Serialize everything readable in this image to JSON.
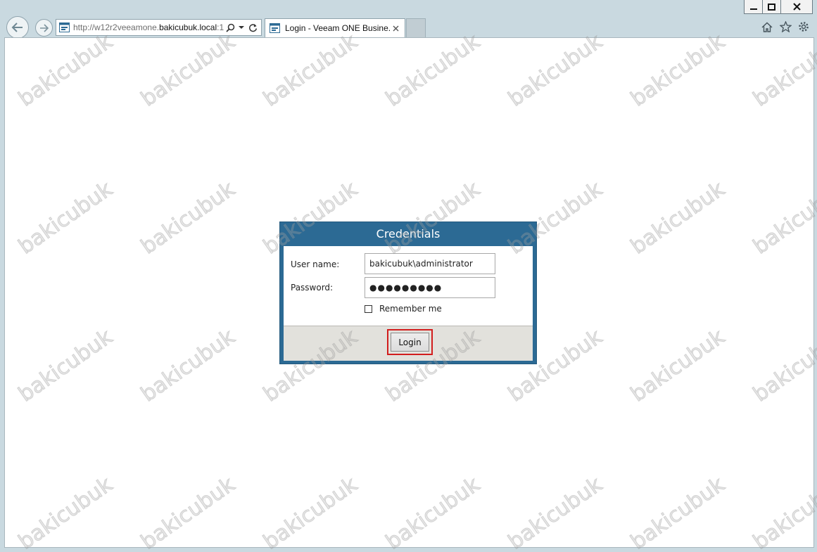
{
  "browser": {
    "address": {
      "prefix": "http://w12r2veeamone.",
      "domain": "bakicubuk.local",
      "suffix": ":1"
    },
    "tab": {
      "title": "Login - Veeam ONE Busine..."
    },
    "icons": [
      "back-icon",
      "forward-icon",
      "page-icon",
      "search-icon",
      "dropdown-icon",
      "refresh-icon",
      "tab-close-icon",
      "home-icon",
      "favorites-star-icon",
      "settings-gear-icon",
      "minimize-icon",
      "maximize-icon",
      "close-icon"
    ]
  },
  "dialog": {
    "title": "Credentials",
    "username_label": "User name:",
    "username_value": "bakicubuk\\administrator",
    "password_label": "Password:",
    "password_value": "●●●●●●●●●",
    "remember_label": "Remember me",
    "remember_checked": false,
    "login_label": "Login"
  },
  "watermark": {
    "text": "bakicubuk"
  },
  "colors": {
    "dialog_header": "#2c6a94",
    "footer": "#e2e1dc",
    "highlight": "#d21d1d",
    "chrome": "#c9d9e0"
  }
}
